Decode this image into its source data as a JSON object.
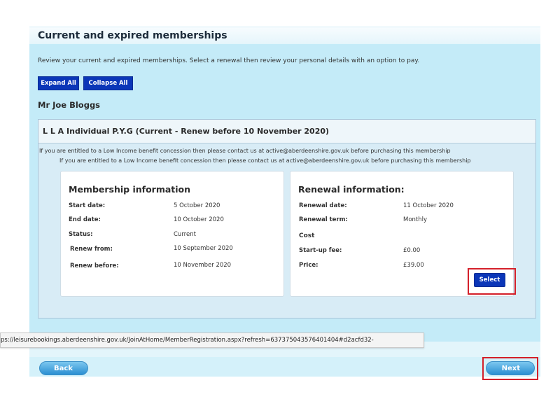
{
  "page": {
    "title": "Current and expired memberships",
    "intro": "Review your current and expired memberships. Select a renewal then review your personal details with an option to pay.",
    "expand_all": "Expand All",
    "collapse_all": "Collapse All",
    "member_name": "Mr Joe Bloggs"
  },
  "membership": {
    "title": "L L A Individual P.Y.G (Current - Renew before 10 November 2020)",
    "notice_1": "If you are entitled to a Low Income benefit concession then please contact us at active@aberdeenshire.gov.uk before purchasing this membership",
    "notice_2": "If you are entitled to a Low Income benefit concession then please contact us at active@aberdeenshire.gov.uk before purchasing this membership",
    "info": {
      "heading": "Membership information",
      "rows": [
        {
          "label": "Start date:",
          "value": "5 October 2020"
        },
        {
          "label": "End date:",
          "value": "10 October 2020"
        },
        {
          "label": "Status:",
          "value": "Current"
        },
        {
          "label": "Renew from:",
          "value": "10 September 2020"
        },
        {
          "label": "Renew before:",
          "value": "10 November 2020"
        }
      ]
    },
    "renewal": {
      "heading": "Renewal information:",
      "renewal_date_label": "Renewal date:",
      "renewal_date": "11 October 2020",
      "renewal_term_label": "Renewal term:",
      "renewal_term": "Monthly",
      "cost_label": "Cost",
      "startup_fee_label": "Start-up fee:",
      "startup_fee": "£0.00",
      "price_label": "Price:",
      "price": "£39.00",
      "select": "Select"
    }
  },
  "status_url": "ps://leisurebookings.aberdeenshire.gov.uk/JoinAtHome/MemberRegistration.aspx?refresh=637375043576401404#d2acfd32-",
  "footer": {
    "back": "Back",
    "next": "Next"
  },
  "colors": {
    "accent_button": "#0b36b8",
    "panel_background": "#c4ebf8",
    "highlight": "#d4202a"
  }
}
